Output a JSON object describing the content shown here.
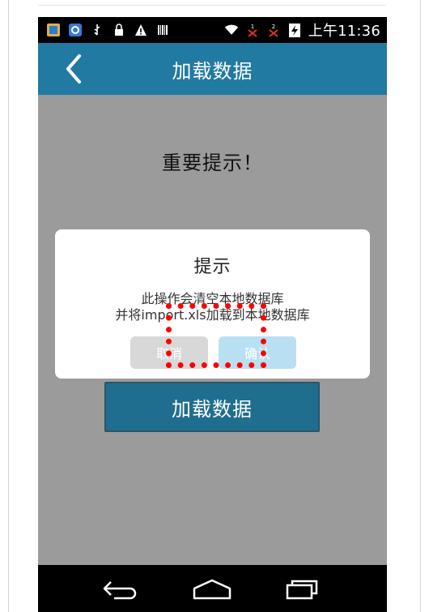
{
  "status_bar": {
    "time": "上午11:36"
  },
  "app_bar": {
    "title": "加载数据"
  },
  "main": {
    "important_text": "重要提示！",
    "load_button_label": "加载数据"
  },
  "dialog": {
    "title": "提示",
    "message_line1": "此操作会清空本地数据库",
    "message_line2": "并将import.xls加载到本地数据库",
    "cancel_label": "取消",
    "confirm_label": "确认"
  },
  "colors": {
    "accent": "#217aa2",
    "highlight": "#ff0000"
  },
  "icons": {
    "back": "chevron-left-icon",
    "nav_back": "back-arrow-icon",
    "nav_home": "home-icon",
    "nav_recents": "recents-icon"
  }
}
